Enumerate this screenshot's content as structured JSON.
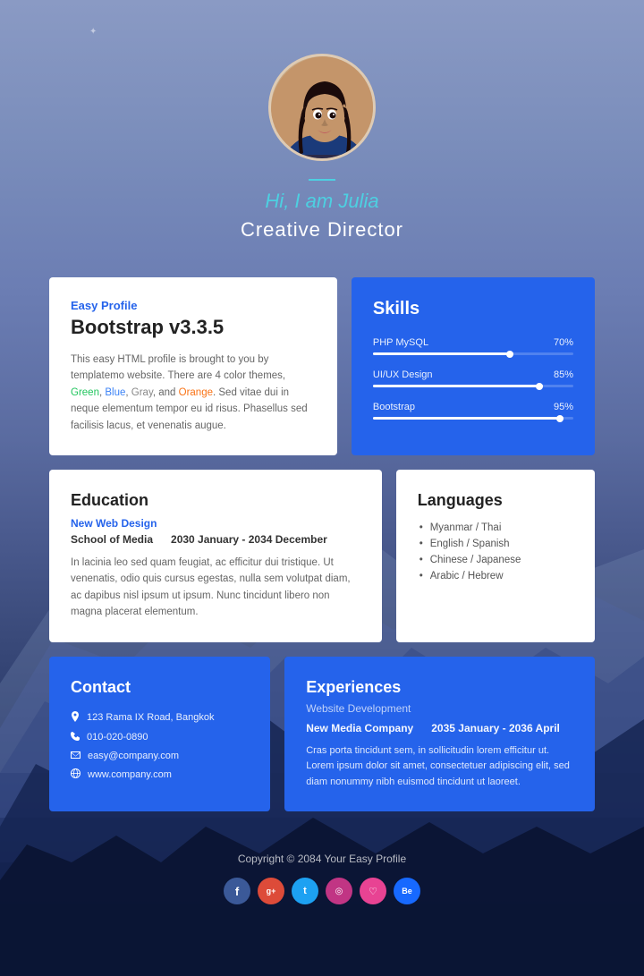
{
  "hero": {
    "greeting": "Hi, I am Julia",
    "title": "Creative Director"
  },
  "profile": {
    "label": "Easy Profile",
    "title": "Bootstrap v3.3.5",
    "description_parts": [
      "This easy HTML profile is brought to you by templatemo website. There are 4 color themes, ",
      "Green",
      ", ",
      "Blue",
      ", ",
      "Gray",
      ", and ",
      "Orange",
      ". Sed vitae dui in neque elementum tempor eu id risus. Phasellus sed facilisis lacus, et venenatis augue."
    ]
  },
  "skills": {
    "title": "Skills",
    "items": [
      {
        "name": "PHP MySQL",
        "percent": 70,
        "label": "70%"
      },
      {
        "name": "UI/UX Design",
        "percent": 85,
        "label": "85%"
      },
      {
        "name": "Bootstrap",
        "percent": 95,
        "label": "95%"
      }
    ]
  },
  "education": {
    "title": "Education",
    "subtitle": "New Web Design",
    "school": "School of Media",
    "period": "2030 January - 2034 December",
    "description": "In lacinia leo sed quam feugiat, ac efficitur dui tristique. Ut venenatis, odio quis cursus egestas, nulla sem volutpat diam, ac dapibus nisl ipsum ut ipsum. Nunc tincidunt libero non magna placerat elementum."
  },
  "languages": {
    "title": "Languages",
    "items": [
      "Myanmar / Thai",
      "English / Spanish",
      "Chinese / Japanese",
      "Arabic / Hebrew"
    ]
  },
  "contact": {
    "title": "Contact",
    "items": [
      {
        "icon": "📍",
        "text": "123 Rama IX Road, Bangkok"
      },
      {
        "icon": "📞",
        "text": "010-020-0890"
      },
      {
        "icon": "✉",
        "text": "easy@company.com"
      },
      {
        "icon": "🌐",
        "text": "www.company.com"
      }
    ]
  },
  "experience": {
    "title": "Experiences",
    "subtitle": "Website Development",
    "company": "New Media Company",
    "period": "2035 January - 2036 April",
    "description": "Cras porta tincidunt sem, in sollicitudin lorem efficitur ut. Lorem ipsum dolor sit amet, consectetuer adipiscing elit, sed diam nonummy nibh euismod tincidunt ut laoreet."
  },
  "footer": {
    "copyright": "Copyright © 2084 Your Easy Profile"
  },
  "social": [
    {
      "icon": "f",
      "label": "facebook"
    },
    {
      "icon": "g+",
      "label": "google-plus"
    },
    {
      "icon": "t",
      "label": "twitter"
    },
    {
      "icon": "in",
      "label": "instagram"
    },
    {
      "icon": "♡",
      "label": "heart"
    },
    {
      "icon": "Be",
      "label": "behance"
    }
  ],
  "colors": {
    "accent": "#2563eb",
    "cyan": "#4dd0e1"
  }
}
